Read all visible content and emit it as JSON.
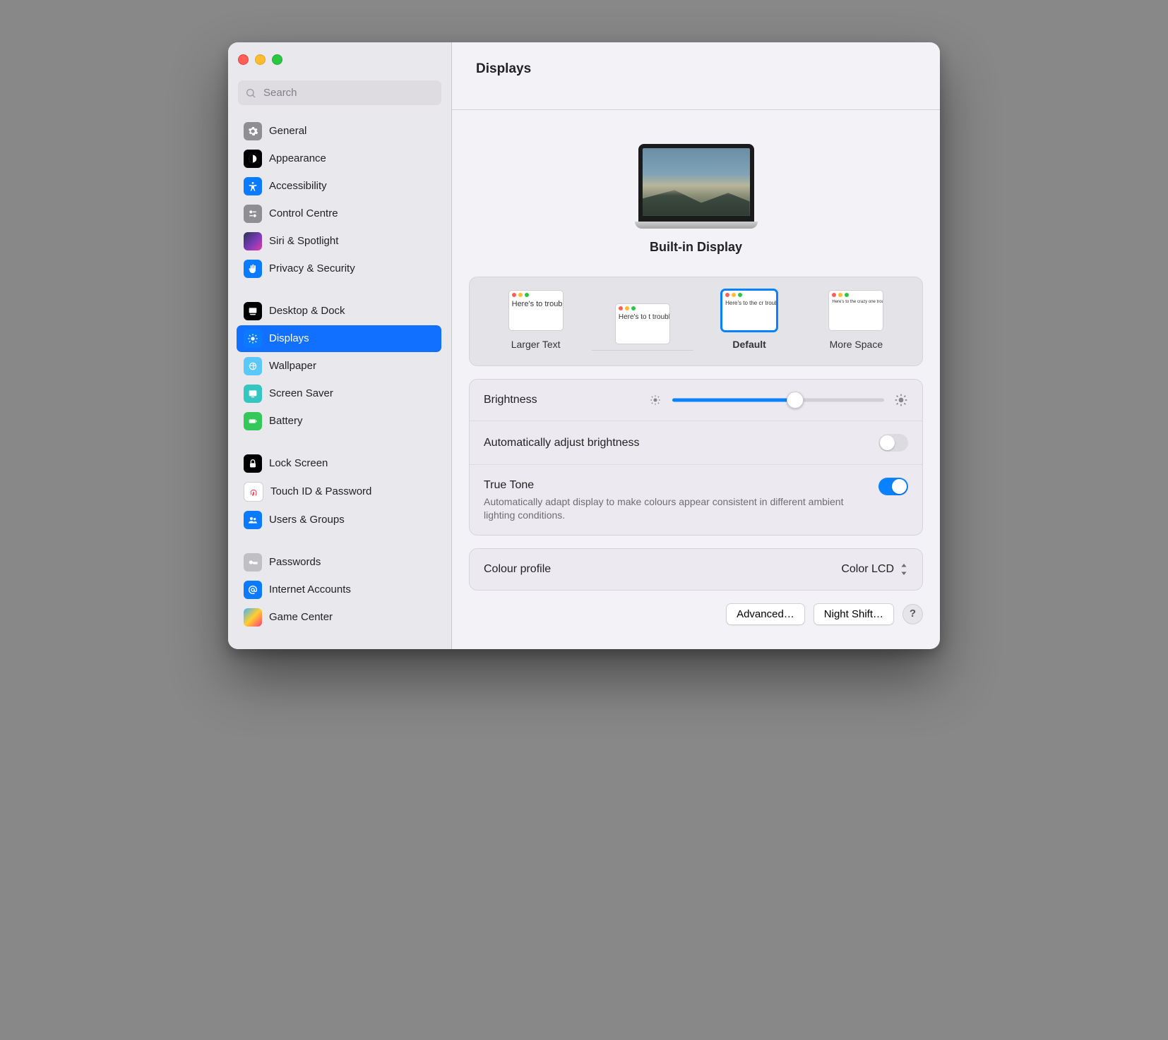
{
  "header": {
    "title": "Displays"
  },
  "search": {
    "placeholder": "Search"
  },
  "sidebar": {
    "groups": [
      {
        "items": [
          {
            "label": "General"
          },
          {
            "label": "Appearance"
          },
          {
            "label": "Accessibility"
          },
          {
            "label": "Control Centre"
          },
          {
            "label": "Siri & Spotlight"
          },
          {
            "label": "Privacy & Security"
          }
        ]
      },
      {
        "items": [
          {
            "label": "Desktop & Dock"
          },
          {
            "label": "Displays"
          },
          {
            "label": "Wallpaper"
          },
          {
            "label": "Screen Saver"
          },
          {
            "label": "Battery"
          }
        ]
      },
      {
        "items": [
          {
            "label": "Lock Screen"
          },
          {
            "label": "Touch ID & Password"
          },
          {
            "label": "Users & Groups"
          }
        ]
      },
      {
        "items": [
          {
            "label": "Passwords"
          },
          {
            "label": "Internet Accounts"
          },
          {
            "label": "Game Center"
          }
        ]
      }
    ]
  },
  "device": {
    "name": "Built-in Display"
  },
  "resolution": {
    "options": [
      {
        "label": "Larger Text",
        "sample": "Here's to troublem"
      },
      {
        "label": "",
        "sample": "Here's to t troublema ones who"
      },
      {
        "label": "Default",
        "sample": "Here's to the cr troublemakers. ones who see t rules. And they"
      },
      {
        "label": "More Space",
        "sample": "Here's to the crazy one troublemakers. The rou ones who see things dif rules. And they have no can quote them, disagr them. About the only th Because they change th"
      }
    ],
    "selected_index": 2
  },
  "brightness": {
    "label": "Brightness",
    "percent": 58,
    "auto_label": "Automatically adjust brightness",
    "auto_on": false,
    "truetone_label": "True Tone",
    "truetone_desc": "Automatically adapt display to make colours appear consistent in different ambient lighting conditions.",
    "truetone_on": true
  },
  "color_profile": {
    "label": "Colour profile",
    "value": "Color LCD"
  },
  "footer": {
    "advanced": "Advanced…",
    "night_shift": "Night Shift…",
    "help": "?"
  }
}
